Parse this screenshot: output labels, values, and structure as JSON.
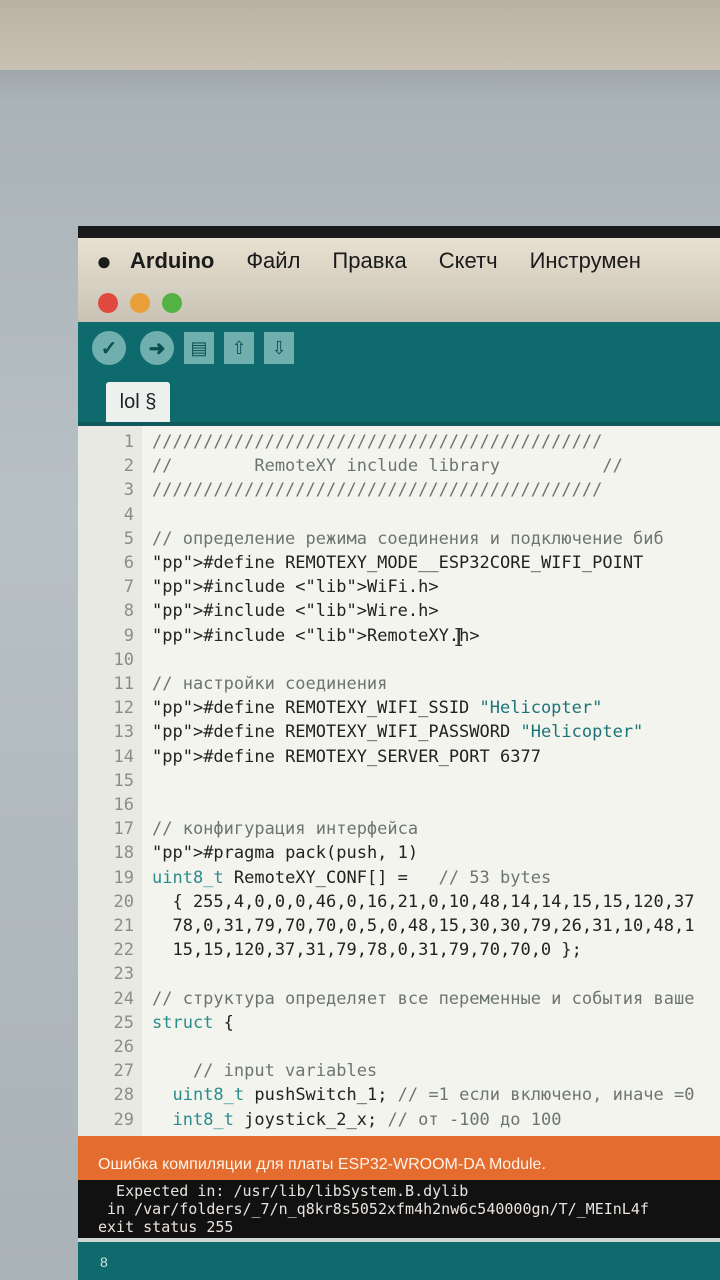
{
  "menubar": {
    "apple_icon": "apple-logo-icon",
    "items": [
      "Arduino",
      "Файл",
      "Правка",
      "Скетч",
      "Инструмен"
    ]
  },
  "toolbar": {
    "verify_icon": "check-icon",
    "upload_icon": "arrow-right-icon",
    "new_icon": "new-file-icon",
    "open_icon": "arrow-up-icon",
    "save_icon": "arrow-down-icon"
  },
  "tab": {
    "label": "lol §"
  },
  "editor": {
    "lines": [
      {
        "n": "1",
        "t": "////////////////////////////////////////////"
      },
      {
        "n": "2",
        "t": "//        RemoteXY include library          //"
      },
      {
        "n": "3",
        "t": "////////////////////////////////////////////"
      },
      {
        "n": "4",
        "t": ""
      },
      {
        "n": "5",
        "t": "// определение режима соединения и подключение биб"
      },
      {
        "n": "6",
        "t": "#define REMOTEXY_MODE__ESP32CORE_WIFI_POINT"
      },
      {
        "n": "7",
        "t": "#include <WiFi.h>"
      },
      {
        "n": "8",
        "t": "#include <Wire.h>"
      },
      {
        "n": "9",
        "t": "#include <RemoteXY.h>"
      },
      {
        "n": "10",
        "t": ""
      },
      {
        "n": "11",
        "t": "// настройки соединения"
      },
      {
        "n": "12",
        "t": "#define REMOTEXY_WIFI_SSID \"Helicopter\""
      },
      {
        "n": "13",
        "t": "#define REMOTEXY_WIFI_PASSWORD \"Helicopter\""
      },
      {
        "n": "14",
        "t": "#define REMOTEXY_SERVER_PORT 6377"
      },
      {
        "n": "15",
        "t": ""
      },
      {
        "n": "16",
        "t": ""
      },
      {
        "n": "17",
        "t": "// конфигурация интерфейса"
      },
      {
        "n": "18",
        "t": "#pragma pack(push, 1)"
      },
      {
        "n": "19",
        "t": "uint8_t RemoteXY_CONF[] =   // 53 bytes"
      },
      {
        "n": "20",
        "t": "  { 255,4,0,0,0,46,0,16,21,0,10,48,14,14,15,15,120,37"
      },
      {
        "n": "21",
        "t": "  78,0,31,79,70,70,0,5,0,48,15,30,30,79,26,31,10,48,1"
      },
      {
        "n": "22",
        "t": "  15,15,120,37,31,79,78,0,31,79,70,70,0 };"
      },
      {
        "n": "23",
        "t": ""
      },
      {
        "n": "24",
        "t": "// структура определяет все переменные и события ваше"
      },
      {
        "n": "25",
        "t": "struct {"
      },
      {
        "n": "26",
        "t": ""
      },
      {
        "n": "27",
        "t": "    // input variables"
      },
      {
        "n": "28",
        "t": "  uint8_t pushSwitch_1; // =1 если включено, иначе =0"
      },
      {
        "n": "29",
        "t": "  int8_t joystick_2_x; // от -100 до 100"
      }
    ]
  },
  "error": {
    "message": "Ошибка компиляции для платы ESP32-WROOM-DA Module."
  },
  "console": {
    "lines": [
      "  Expected in: /usr/lib/libSystem.B.dylib",
      " in /var/folders/_7/n_q8kr8s5052xfm4h2nw6c540000gn/T/_MEInL4f",
      "exit status 255"
    ]
  },
  "status": {
    "line_number": "8"
  },
  "colors": {
    "toolbar": "#0f6a6e",
    "error_bar": "#e46c2e",
    "editor_bg": "#f3f4ee"
  }
}
